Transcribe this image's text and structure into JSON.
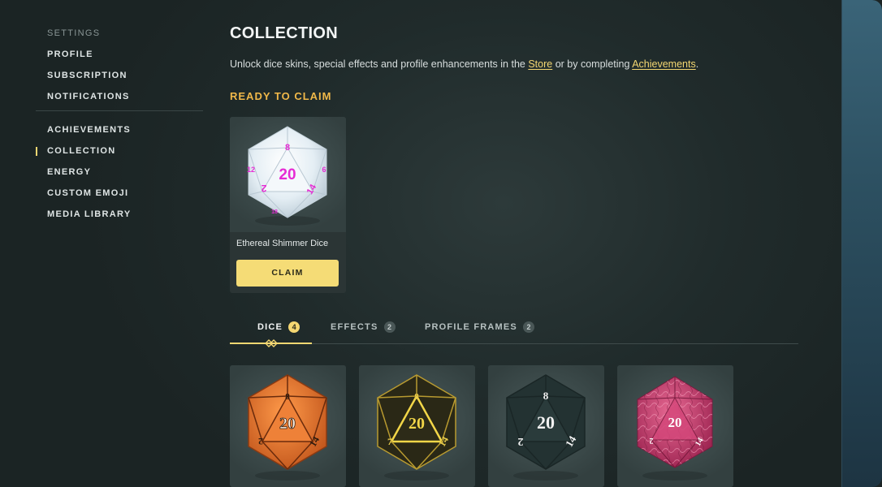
{
  "sidebar": {
    "heading": "SETTINGS",
    "group1": [
      "PROFILE",
      "SUBSCRIPTION",
      "NOTIFICATIONS"
    ],
    "group2": [
      "ACHIEVEMENTS",
      "COLLECTION",
      "ENERGY",
      "CUSTOM EMOJI",
      "MEDIA LIBRARY"
    ],
    "active": "COLLECTION"
  },
  "page": {
    "title": "COLLECTION",
    "subtitle_before": "Unlock dice skins, special effects and profile enhancements in the ",
    "store_link": "Store",
    "subtitle_middle": " or by completing ",
    "achievements_link": "Achievements",
    "subtitle_after": "."
  },
  "ready": {
    "title": "READY TO CLAIM",
    "item_name": "Ethereal Shimmer Dice",
    "claim_label": "CLAIM",
    "dice_numbers": [
      "8",
      "20",
      "12",
      "2",
      "14",
      "6",
      "18"
    ]
  },
  "tabs": [
    {
      "label": "DICE",
      "count": "4",
      "active": true
    },
    {
      "label": "EFFECTS",
      "count": "2",
      "active": false
    },
    {
      "label": "PROFILE FRAMES",
      "count": "2",
      "active": false
    }
  ],
  "dice_grid": [
    {
      "name": "orange-dice",
      "top_number": "8",
      "center_number": "20",
      "left_number": "2",
      "right_number": "14",
      "face_color": "#e8772c",
      "number_color": "#2b1a0e"
    },
    {
      "name": "gold-black-dice",
      "top_number": "8",
      "center_number": "20",
      "left_number": "7",
      "right_number": "14",
      "face_color": "#262416",
      "number_color": "#e8cc4c"
    },
    {
      "name": "dark-teal-dice",
      "top_number": "8",
      "center_number": "20",
      "left_number": "2",
      "right_number": "14",
      "face_color": "#243434",
      "number_color": "#f2f2f2"
    },
    {
      "name": "pink-dice",
      "top_number": "",
      "center_number": "20",
      "left_number": "2",
      "right_number": "14",
      "face_color": "#c33a6a",
      "number_color": "#ffffff"
    }
  ],
  "colors": {
    "accent": "#f4d772",
    "section_title": "#f0b849",
    "background": "#1f2929"
  }
}
